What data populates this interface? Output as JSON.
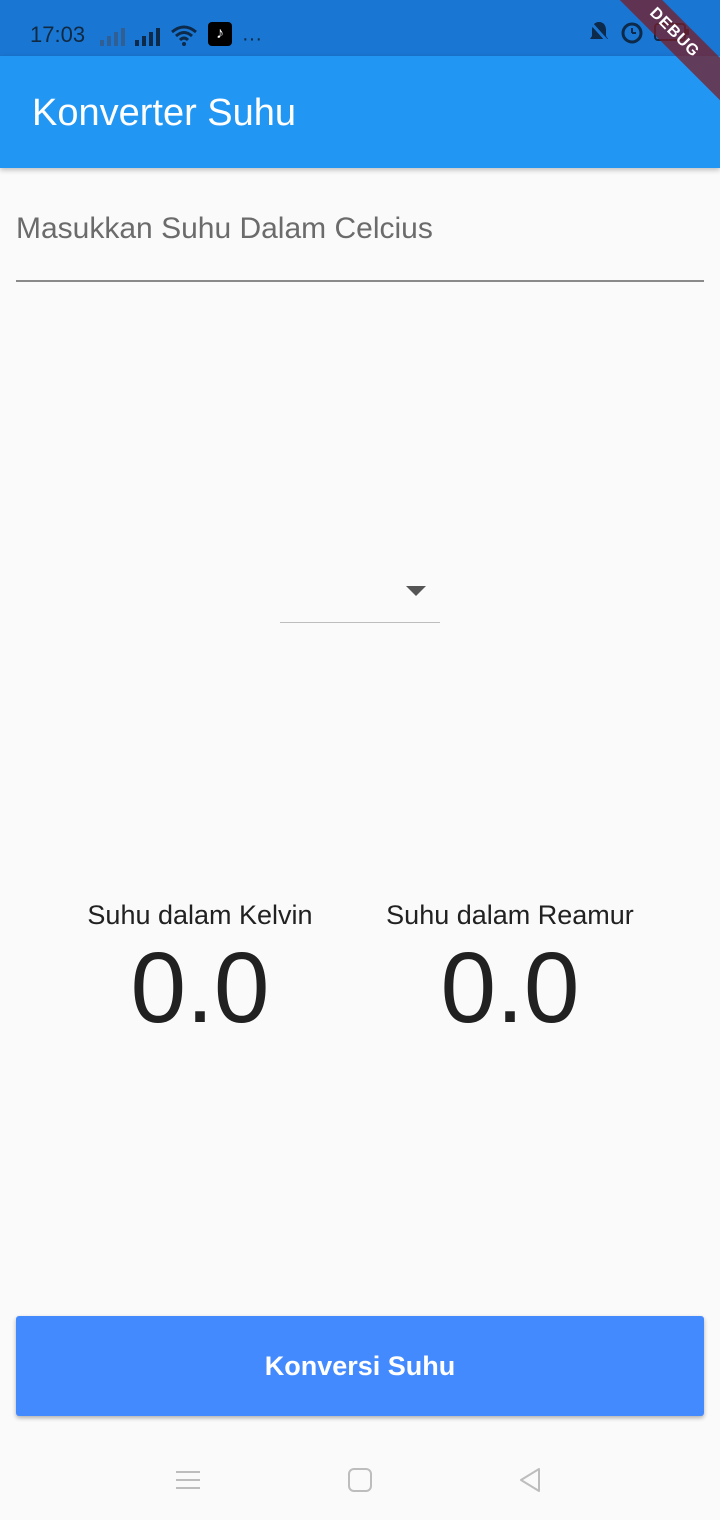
{
  "status_bar": {
    "time": "17:03",
    "overflow": "···",
    "icons": [
      "signal-x-icon",
      "signal-icon",
      "wifi-icon",
      "tiktok-icon",
      "bell-off-icon",
      "alarm-icon",
      "battery-icon"
    ]
  },
  "debug_banner": "DEBUG",
  "app_bar": {
    "title": "Konverter Suhu"
  },
  "input": {
    "placeholder": "Masukkan Suhu Dalam Celcius",
    "value": ""
  },
  "dropdown": {
    "selected": ""
  },
  "results": {
    "kelvin": {
      "label": "Suhu dalam Kelvin",
      "value": "0.0"
    },
    "reamur": {
      "label": "Suhu dalam Reamur",
      "value": "0.0"
    }
  },
  "button": {
    "label": "Konversi Suhu"
  },
  "colors": {
    "app_bar": "#2196f3",
    "status_bar": "#1976d2",
    "button": "#448aff",
    "background": "#fafafa"
  }
}
